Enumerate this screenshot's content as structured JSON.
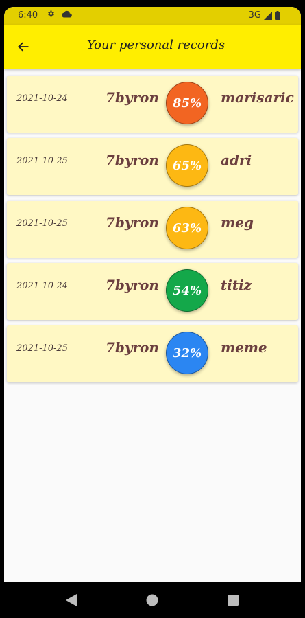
{
  "status_bar": {
    "time": "6:40",
    "network": "3G"
  },
  "app_bar": {
    "title": "Your personal records"
  },
  "records": [
    {
      "date": "2021-10-24",
      "user": "7byron",
      "score": "85%",
      "opponent": "marisaric",
      "color": "#f26522"
    },
    {
      "date": "2021-10-25",
      "user": "7byron",
      "score": "65%",
      "opponent": "adri",
      "color": "#fdb813"
    },
    {
      "date": "2021-10-25",
      "user": "7byron",
      "score": "63%",
      "opponent": "meg",
      "color": "#fdb813"
    },
    {
      "date": "2021-10-24",
      "user": "7byron",
      "score": "54%",
      "opponent": "titiz",
      "color": "#14a84a"
    },
    {
      "date": "2021-10-25",
      "user": "7byron",
      "score": "32%",
      "opponent": "meme",
      "color": "#2b86f2"
    }
  ],
  "colors": {
    "app_bar": "#ffee00",
    "status_bar": "#e3cf00",
    "card": "#fff8c4",
    "text": "#6b3f3f"
  },
  "icons": {
    "back": "arrow-left-icon",
    "settings": "gear-icon",
    "cloud": "cloud-icon",
    "signal": "signal-icon",
    "battery": "battery-icon",
    "nav_back": "triangle-back-icon",
    "nav_home": "circle-home-icon",
    "nav_recents": "square-recents-icon"
  }
}
